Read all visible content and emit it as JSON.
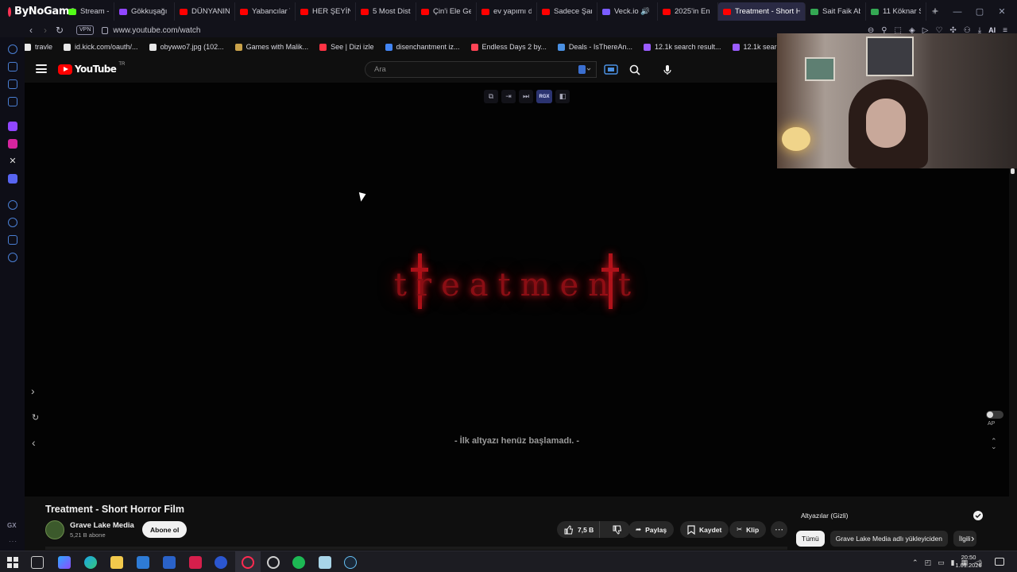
{
  "browser": {
    "name": "ByNoGame",
    "tabs": [
      {
        "label": "Stream - Kick",
        "color": "#53fc18"
      },
      {
        "label": "Gökkuşağı |",
        "color": "#9146ff"
      },
      {
        "label": "DÜNYANIN E",
        "color": "#ff0000"
      },
      {
        "label": "Yabancılar T",
        "color": "#ff0000"
      },
      {
        "label": "HER ŞEYİN S",
        "color": "#ff0000"
      },
      {
        "label": "5 Most Distu",
        "color": "#ff0000"
      },
      {
        "label": "Çin'i Ele Geç",
        "color": "#ff0000"
      },
      {
        "label": "ev yapımı de",
        "color": "#ff0000"
      },
      {
        "label": "Sadece Şark",
        "color": "#ff0000"
      },
      {
        "label": "Veck.io 🔊 P",
        "color": "#7a5cff"
      },
      {
        "label": "2025'in En M",
        "color": "#ff0000"
      },
      {
        "label": "Treatment - Short H",
        "color": "#ff0000",
        "active": true
      },
      {
        "label": "Sait Faik Ab",
        "color": "#34a853"
      },
      {
        "label": "11 Köknar Sk",
        "color": "#34a853"
      }
    ],
    "new_tab": "+",
    "vpn_label": "VPN",
    "url": "www.youtube.com/watch",
    "ai_label": "AI"
  },
  "bookmarks": [
    {
      "label": "travle",
      "color": "#e8e8e8"
    },
    {
      "label": "id.kick.com/oauth/...",
      "color": "#e8e8e8"
    },
    {
      "label": "obywwo7.jpg (102...",
      "color": "#e8e8e8"
    },
    {
      "label": "Games with Malik...",
      "color": "#c9a24a"
    },
    {
      "label": "See | Dizi izle",
      "color": "#ff3344"
    },
    {
      "label": "disenchantment iz...",
      "color": "#4285f4"
    },
    {
      "label": "Endless Days 2 by...",
      "color": "#ff4455"
    },
    {
      "label": "Deals - IsThereAn...",
      "color": "#4a90e2"
    },
    {
      "label": "12.1k search result...",
      "color": "#9a5cff"
    },
    {
      "label": "12.1k search result...",
      "color": "#9a5cff"
    }
  ],
  "youtube": {
    "logo_text": "YouTube",
    "region": "TR",
    "search_placeholder": "Ara"
  },
  "player": {
    "title_art": "treatment",
    "subtitle": "- İlk altyazı henüz başlamadı. -",
    "ap_label": "AP",
    "rgx_label": "RGX"
  },
  "video": {
    "title": "Treatment - Short Horror Film",
    "channel": "Grave Lake Media",
    "subscribers": "5,21 B abone",
    "subscribe_label": "Abone ol",
    "likes": "7,5 B",
    "share_label": "Paylaş",
    "save_label": "Kaydet",
    "clip_label": "Klip"
  },
  "side_panel": {
    "captions_label": "Altyazılar (Gizli)",
    "chips": [
      "Tümü",
      "Grave Lake Media adlı yükleyiciden",
      "İlgili"
    ]
  },
  "taskbar": {
    "time": "20:50",
    "date": "1.01.2026"
  }
}
